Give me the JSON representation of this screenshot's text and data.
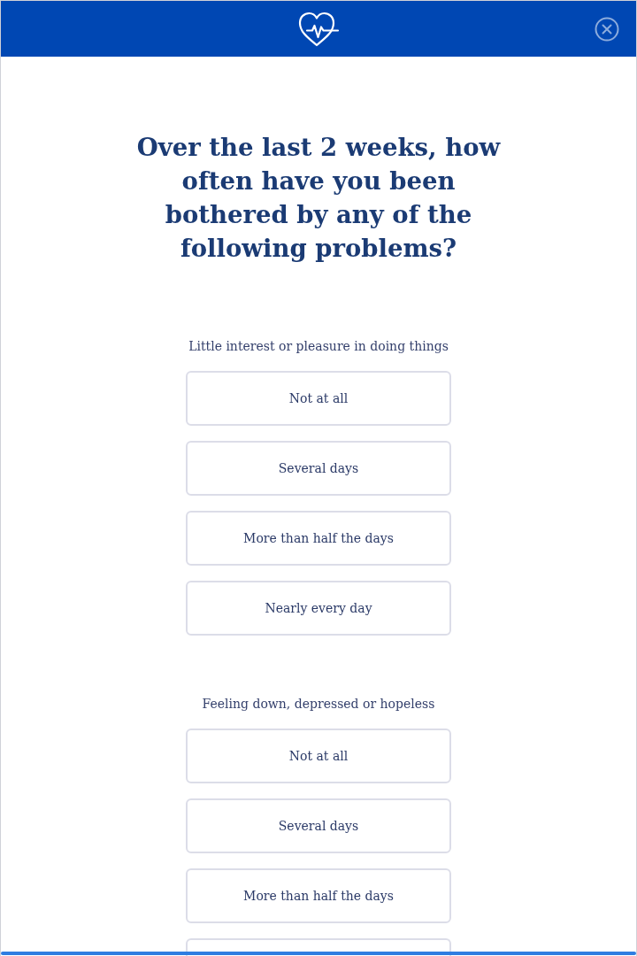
{
  "title": "Over the last 2 weeks, how often have you been bothered by any of the following problems?",
  "questions": [
    {
      "text": "Little interest or pleasure in doing things",
      "options": [
        {
          "label": "Not at all",
          "selected": false
        },
        {
          "label": "Several days",
          "selected": false
        },
        {
          "label": "More than half the days",
          "selected": false
        },
        {
          "label": "Nearly every day",
          "selected": false
        }
      ]
    },
    {
      "text": "Feeling down, depressed or hopeless",
      "options": [
        {
          "label": "Not at all",
          "selected": false
        },
        {
          "label": "Several days",
          "selected": false
        },
        {
          "label": "More than half the days",
          "selected": false
        },
        {
          "selected": false
        }
      ]
    }
  ]
}
